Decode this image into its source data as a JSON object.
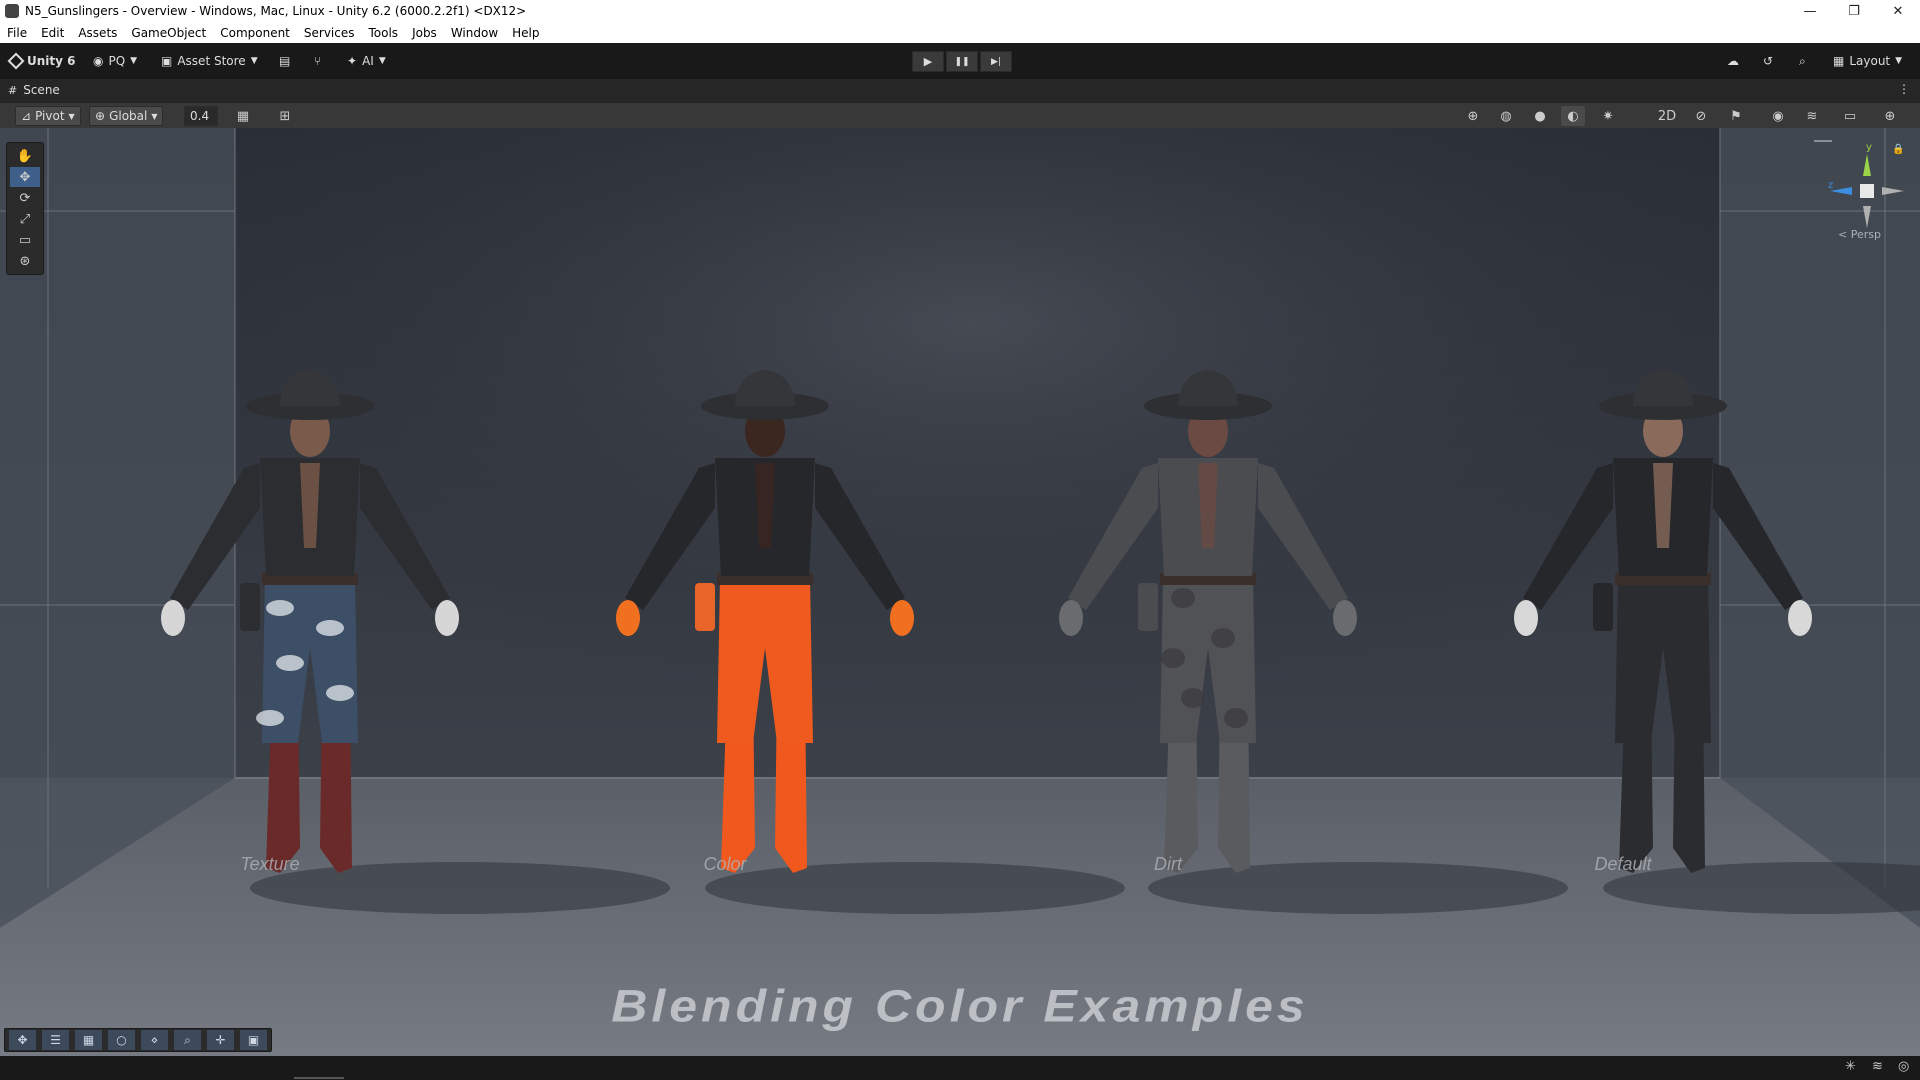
{
  "window": {
    "title": "N5_Gunslingers - Overview - Windows, Mac, Linux - Unity 6.2 (6000.2.2f1) <DX12>",
    "minimize": "—",
    "maximize": "❐",
    "close": "✕"
  },
  "menu": [
    "File",
    "Edit",
    "Assets",
    "GameObject",
    "Component",
    "Services",
    "Tools",
    "Jobs",
    "Window",
    "Help"
  ],
  "toolbar": {
    "unity_label": "Unity 6",
    "account": "PQ",
    "asset_store": "Asset Store",
    "ai": "AI",
    "layout": "Layout"
  },
  "scene_tab": {
    "label": "Scene"
  },
  "scene_toolbar": {
    "pivot": "Pivot",
    "global": "Global",
    "snap_value": "0.4",
    "two_d": "2D"
  },
  "gizmo": {
    "y_label": "y",
    "z_label": "z",
    "persp_label": "< Persp"
  },
  "scene": {
    "floor_text": "Blending Color Examples",
    "characters": [
      {
        "label": "Texture",
        "jacket": "#2b2d31",
        "pants": "#3c4f66",
        "boots": "#6a2a2a",
        "gloves": "#d6d6d6",
        "skin": "#7a5a4a",
        "pantsPattern": "camo"
      },
      {
        "label": "Color",
        "jacket": "#25272b",
        "pants": "#ef5a1f",
        "boots": "#f0581e",
        "gloves": "#f07020",
        "skin": "#3b2620",
        "pantsPattern": "solid"
      },
      {
        "label": "Dirt",
        "jacket": "#4a4c50",
        "pants": "#505256",
        "boots": "#5a5b5e",
        "gloves": "#6a6b6e",
        "skin": "#6a4a42",
        "pantsPattern": "grime"
      },
      {
        "label": "Default",
        "jacket": "#25272b",
        "pants": "#2a2c30",
        "boots": "#2b2c30",
        "gloves": "#d8d8d8",
        "skin": "#8a6a5a",
        "pantsPattern": "solid"
      }
    ]
  },
  "icons": {
    "play": "▶",
    "pause": "❚❚",
    "step": "▶|"
  }
}
